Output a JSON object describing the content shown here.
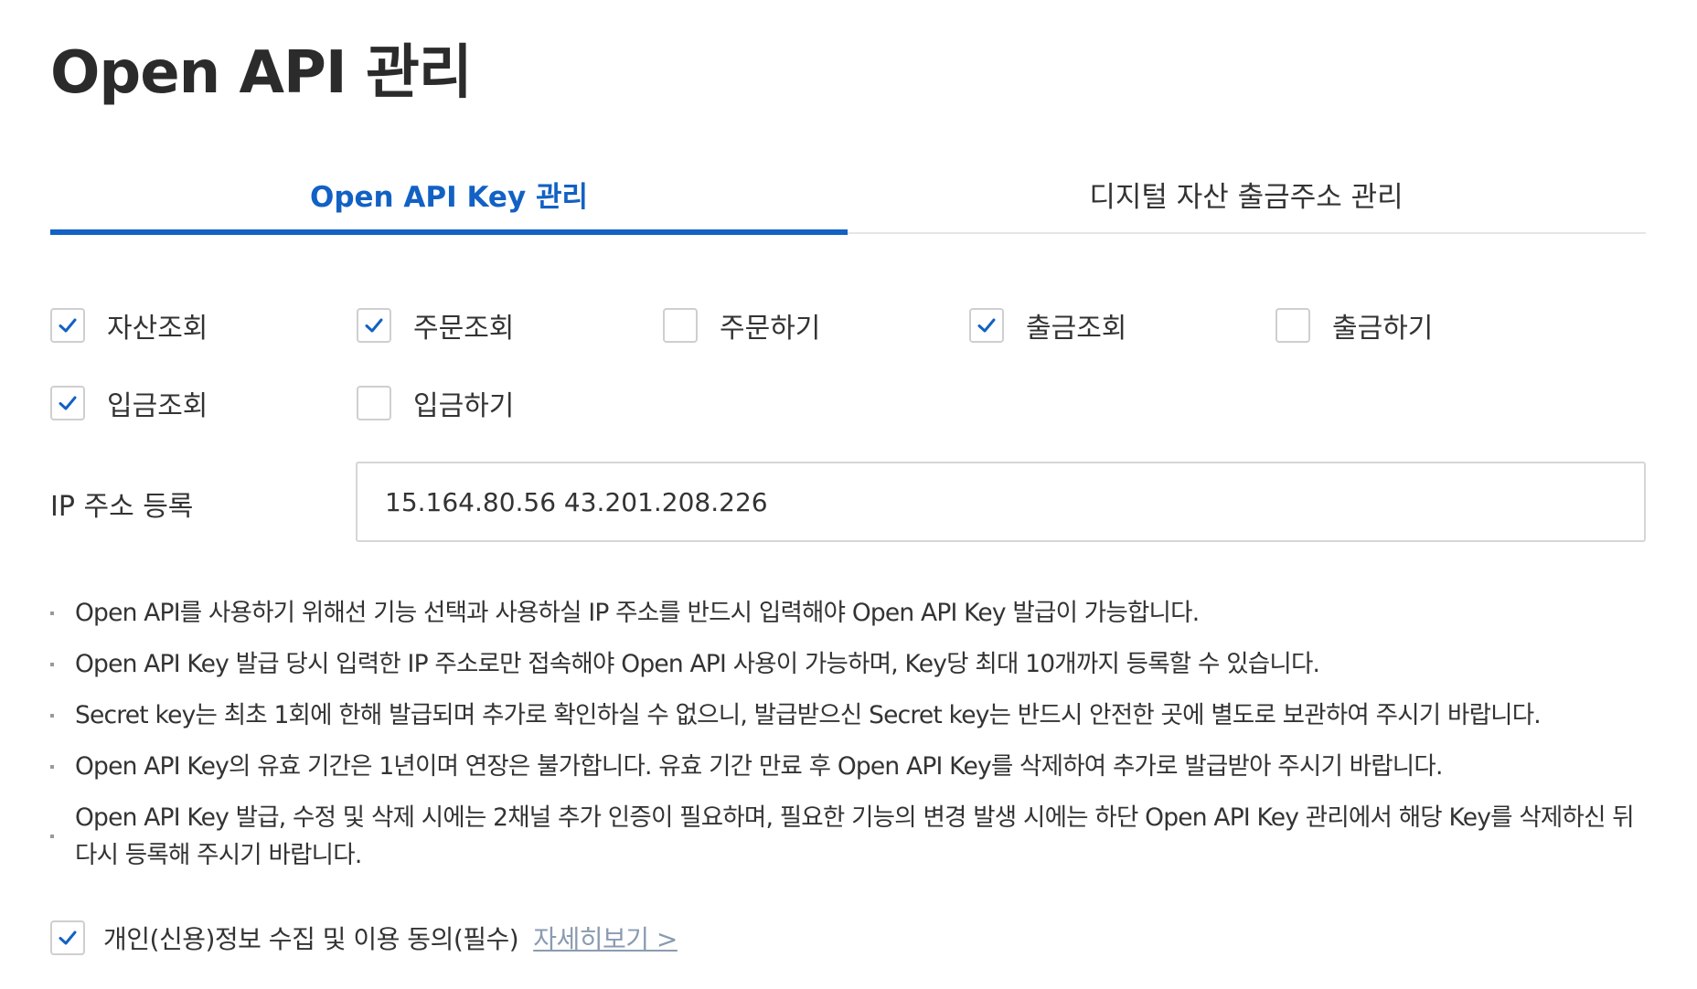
{
  "page_title": "Open API 관리",
  "tabs": [
    {
      "label": "Open API Key 관리",
      "active": true
    },
    {
      "label": "디지털 자산 출금주소 관리",
      "active": false
    }
  ],
  "permissions": [
    {
      "label": "자산조회",
      "checked": true
    },
    {
      "label": "주문조회",
      "checked": true
    },
    {
      "label": "주문하기",
      "checked": false
    },
    {
      "label": "출금조회",
      "checked": true
    },
    {
      "label": "출금하기",
      "checked": false
    },
    {
      "label": "입금조회",
      "checked": true
    },
    {
      "label": "입금하기",
      "checked": false
    }
  ],
  "ip": {
    "label": "IP 주소 등록",
    "value": "15.164.80.56 43.201.208.226"
  },
  "notes": [
    "Open API를 사용하기 위해선 기능 선택과 사용하실 IP 주소를 반드시 입력해야 Open API Key 발급이 가능합니다.",
    "Open API Key 발급 당시 입력한 IP 주소로만 접속해야 Open API 사용이 가능하며, Key당 최대 10개까지 등록할 수 있습니다.",
    "Secret key는 최초 1회에 한해 발급되며 추가로 확인하실 수 없으니, 발급받으신 Secret key는 반드시 안전한 곳에 별도로 보관하여 주시기 바랍니다.",
    "Open API Key의 유효 기간은 1년이며 연장은 불가합니다. 유효 기간 만료 후 Open API Key를 삭제하여 추가로 발급받아 주시기 바랍니다.",
    "Open API Key 발급, 수정 및 삭제 시에는 2채널 추가 인증이 필요하며, 필요한 기능의 변경 발생 시에는 하단 Open API Key 관리에서 해당 Key를 삭제하신 뒤 다시 등록해 주시기 바랍니다."
  ],
  "consent": {
    "label": "개인(신용)정보 수집 및 이용 동의(필수)",
    "checked": true,
    "detail_link": "자세히보기 >"
  },
  "colors": {
    "accent": "#1261c4",
    "text": "#333333",
    "checkbox_border": "#cfcfcf",
    "link": "#8a9bb0"
  }
}
